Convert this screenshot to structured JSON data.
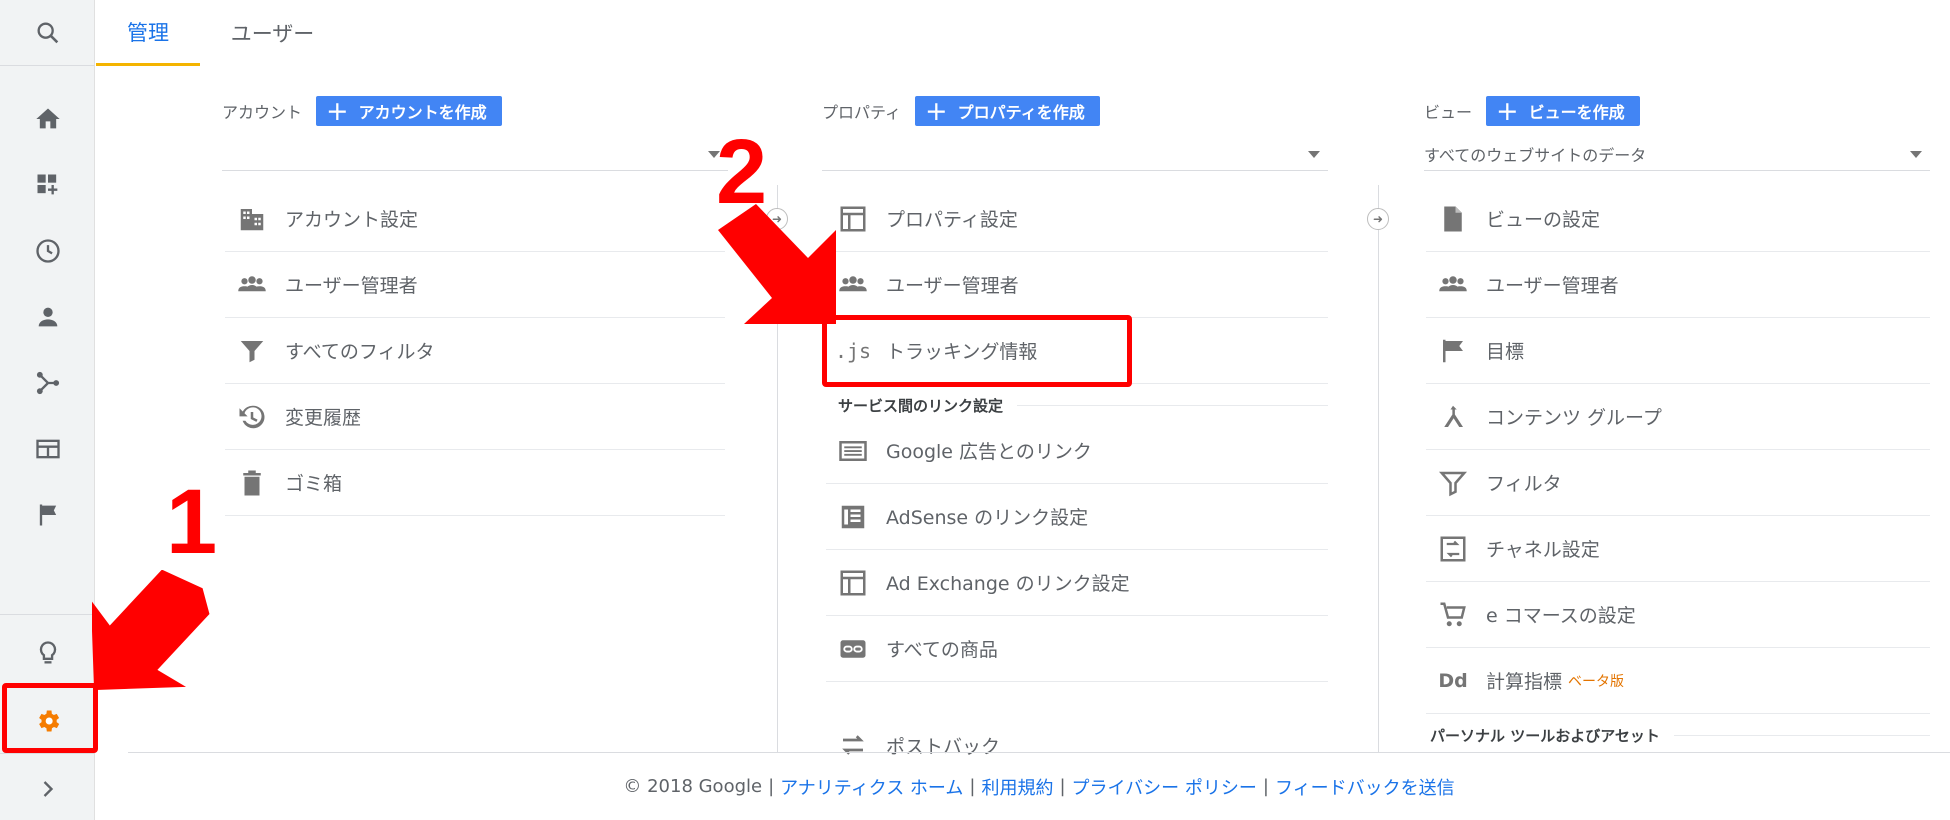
{
  "tabs": [
    {
      "label": "管理"
    },
    {
      "label": "ユーザー"
    }
  ],
  "rail": [
    {
      "icon": "search-icon"
    },
    {
      "icon": "home-icon"
    },
    {
      "icon": "dashboard-add-icon"
    },
    {
      "icon": "clock-icon"
    },
    {
      "icon": "person-icon"
    },
    {
      "icon": "branch-icon"
    },
    {
      "icon": "window-icon"
    },
    {
      "icon": "flag-icon"
    },
    {
      "icon": "lightbulb-icon"
    },
    {
      "icon": "gear-icon"
    },
    {
      "icon": "chevron-right-icon"
    }
  ],
  "account": {
    "label": "アカウント",
    "create_label": "アカウントを作成",
    "selected": "",
    "items": [
      {
        "icon": "building-icon",
        "label": "アカウント設定"
      },
      {
        "icon": "people-icon",
        "label": "ユーザー管理者"
      },
      {
        "icon": "filter-icon",
        "label": "すべてのフィルタ"
      },
      {
        "icon": "history-icon",
        "label": "変更履歴"
      },
      {
        "icon": "trash-icon",
        "label": "ゴミ箱"
      }
    ]
  },
  "property": {
    "label": "プロパティ",
    "create_label": "プロパティを作成",
    "selected": "",
    "items": [
      {
        "icon": "property-icon",
        "label": "プロパティ設定"
      },
      {
        "icon": "people-icon",
        "label": "ユーザー管理者"
      },
      {
        "icon": "js-icon",
        "icon_text": ".js",
        "label": "トラッキング情報"
      }
    ],
    "section_title": "サービス間のリンク設定",
    "links": [
      {
        "icon": "google-ads-icon",
        "label": "Google 広告とのリンク"
      },
      {
        "icon": "adsense-icon",
        "label": "AdSense のリンク設定"
      },
      {
        "icon": "ad-exchange-icon",
        "label": "Ad Exchange のリンク設定"
      },
      {
        "icon": "link-icon",
        "label": "すべての商品"
      },
      {
        "icon": "postback-icon",
        "label": "ポストバック"
      }
    ]
  },
  "view": {
    "label": "ビュー",
    "create_label": "ビューを作成",
    "selected": "すべてのウェブサイトのデータ",
    "items": [
      {
        "icon": "document-icon",
        "label": "ビューの設定"
      },
      {
        "icon": "people-icon",
        "label": "ユーザー管理者"
      },
      {
        "icon": "flag-icon",
        "label": "目標"
      },
      {
        "icon": "content-group-icon",
        "label": "コンテンツ グループ"
      },
      {
        "icon": "filter-icon",
        "label": "フィルタ"
      },
      {
        "icon": "channel-icon",
        "label": "チャネル設定"
      },
      {
        "icon": "cart-icon",
        "label": "e コマースの設定"
      },
      {
        "icon": "dd-icon",
        "icon_text": "Dd",
        "label": "計算指標",
        "badge": "ベータ版"
      }
    ],
    "section_title": "パーソナル ツールおよびアセット"
  },
  "footer": {
    "copyright": "© 2018 Google",
    "links": [
      "アナリティクス ホーム",
      "利用規約",
      "プライバシー ポリシー",
      "フィードバックを送信"
    ],
    "separator": "|"
  },
  "annotations": {
    "step1": "1",
    "step2": "2"
  },
  "colors": {
    "accent": "#1a73e8",
    "button": "#4285f4",
    "active_gear": "#f57c00",
    "annotation": "#ff0000",
    "tab_underline": "#f4b400"
  }
}
